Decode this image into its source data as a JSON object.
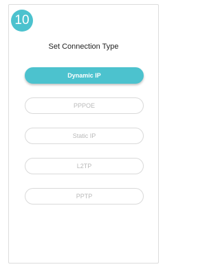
{
  "step": {
    "number": "10"
  },
  "screen": {
    "title": "Set Connection Type"
  },
  "options": [
    {
      "label": "Dynamic IP",
      "selected": true
    },
    {
      "label": "PPPOE",
      "selected": false
    },
    {
      "label": "Static IP",
      "selected": false
    },
    {
      "label": "L2TP",
      "selected": false
    },
    {
      "label": "PPTP",
      "selected": false
    }
  ],
  "colors": {
    "accent": "#4cc2ce",
    "border": "#d9d9d9",
    "inactive_text": "#b9b9b9"
  }
}
